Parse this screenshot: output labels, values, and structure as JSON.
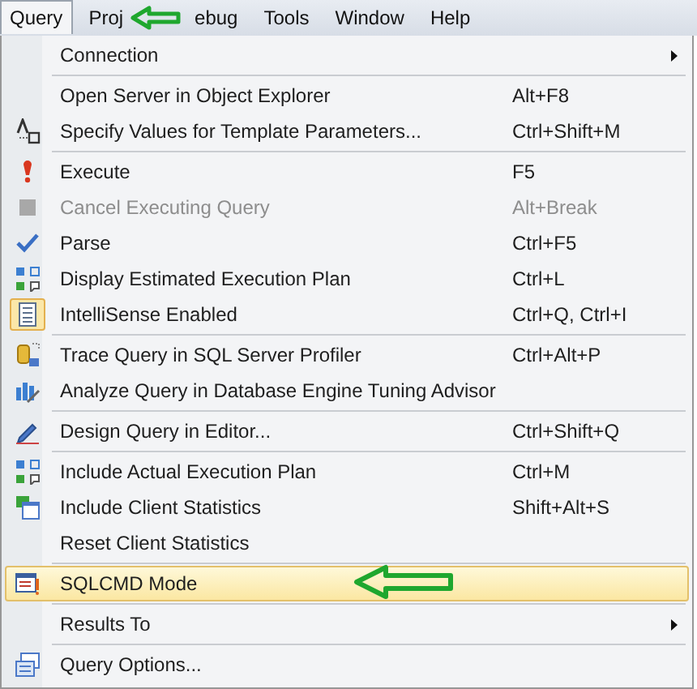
{
  "menubar": [
    {
      "label": "Query",
      "selected": true
    },
    {
      "label": "Proj",
      "selected": false
    },
    {
      "label": "ebug",
      "selected": false
    },
    {
      "label": "Tools",
      "selected": false
    },
    {
      "label": "Window",
      "selected": false
    },
    {
      "label": "Help",
      "selected": false
    }
  ],
  "menu": [
    {
      "kind": "item",
      "label": "Connection",
      "submenu": true,
      "disabled": false,
      "checked": false,
      "selected": false
    },
    {
      "kind": "separator"
    },
    {
      "kind": "item",
      "label": "Open Server in Object Explorer",
      "shortcut": "Alt+F8",
      "submenu": false,
      "disabled": false,
      "checked": false,
      "selected": false
    },
    {
      "kind": "item",
      "label": "Specify Values for Template Parameters...",
      "shortcut": "Ctrl+Shift+M",
      "submenu": false,
      "disabled": false,
      "checked": false,
      "selected": false
    },
    {
      "kind": "separator"
    },
    {
      "kind": "item",
      "label": "Execute",
      "shortcut": "F5",
      "submenu": false,
      "disabled": false,
      "checked": false,
      "selected": false
    },
    {
      "kind": "item",
      "label": "Cancel Executing Query",
      "shortcut": "Alt+Break",
      "submenu": false,
      "disabled": true,
      "checked": false,
      "selected": false
    },
    {
      "kind": "item",
      "label": "Parse",
      "shortcut": "Ctrl+F5",
      "submenu": false,
      "disabled": false,
      "checked": false,
      "selected": false
    },
    {
      "kind": "item",
      "label": "Display Estimated Execution Plan",
      "shortcut": "Ctrl+L",
      "submenu": false,
      "disabled": false,
      "checked": false,
      "selected": false
    },
    {
      "kind": "item",
      "label": "IntelliSense Enabled",
      "shortcut": "Ctrl+Q, Ctrl+I",
      "submenu": false,
      "disabled": false,
      "checked": true,
      "selected": false
    },
    {
      "kind": "separator"
    },
    {
      "kind": "item",
      "label": "Trace Query in SQL Server Profiler",
      "shortcut": "Ctrl+Alt+P",
      "submenu": false,
      "disabled": false,
      "checked": false,
      "selected": false
    },
    {
      "kind": "item",
      "label": "Analyze Query in Database Engine Tuning Advisor",
      "submenu": false,
      "disabled": false,
      "checked": false,
      "selected": false
    },
    {
      "kind": "separator"
    },
    {
      "kind": "item",
      "label": "Design Query in Editor...",
      "shortcut": "Ctrl+Shift+Q",
      "submenu": false,
      "disabled": false,
      "checked": false,
      "selected": false
    },
    {
      "kind": "separator"
    },
    {
      "kind": "item",
      "label": "Include Actual Execution Plan",
      "shortcut": "Ctrl+M",
      "submenu": false,
      "disabled": false,
      "checked": false,
      "selected": false
    },
    {
      "kind": "item",
      "label": "Include Client Statistics",
      "shortcut": "Shift+Alt+S",
      "submenu": false,
      "disabled": false,
      "checked": false,
      "selected": false
    },
    {
      "kind": "item",
      "label": "Reset Client Statistics",
      "submenu": false,
      "disabled": false,
      "checked": false,
      "selected": false
    },
    {
      "kind": "separator"
    },
    {
      "kind": "item",
      "label": "SQLCMD Mode",
      "submenu": false,
      "disabled": false,
      "checked": false,
      "selected": true
    },
    {
      "kind": "separator"
    },
    {
      "kind": "item",
      "label": "Results To",
      "submenu": true,
      "disabled": false,
      "checked": false,
      "selected": false
    },
    {
      "kind": "separator"
    },
    {
      "kind": "item",
      "label": "Query Options...",
      "submenu": false,
      "disabled": false,
      "checked": false,
      "selected": false
    }
  ]
}
